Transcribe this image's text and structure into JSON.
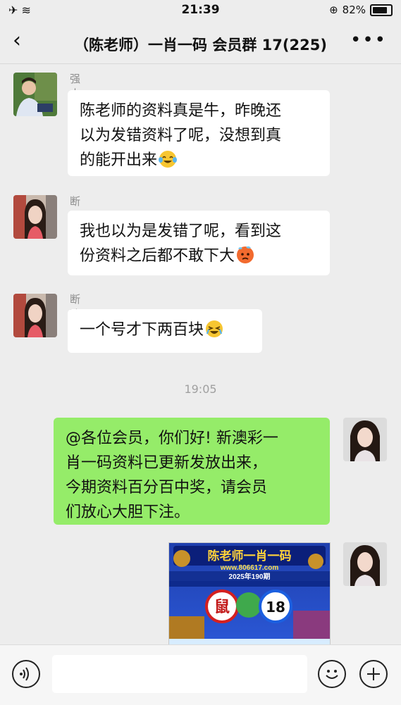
{
  "status_bar": {
    "time": "21:39",
    "battery": "82%",
    "battery_level": 0.82,
    "left_icons": "✈ ≋",
    "location_icon": "⊕"
  },
  "header": {
    "back_icon": "‹",
    "title": "（陈老师）一肖一码 会员群 17(225)",
    "more_icon": "•••"
  },
  "messages": [
    {
      "sender": "强大自我",
      "text_lines": [
        "陈老师的资料真是牛，昨晚还",
        "以为发错资料了呢，没想到真",
        "的能开出来"
      ],
      "emoji": "laugh-cry"
    },
    {
      "sender": "断弦的梦",
      "text_lines": [
        "我也以为是发错了呢，看到这",
        "份资料之后都不敢下大"
      ],
      "emoji": "sweat"
    },
    {
      "sender": "断弦的梦",
      "text_lines": [
        "一个号才下两百块"
      ],
      "emoji": "cry-laugh"
    }
  ],
  "timestamp": "19:05",
  "my_message": {
    "text_lines": [
      "@各位会员，你们好! 新澳彩一",
      "肖一码资料已更新发放出来，",
      "今期资料百分百中奖，请会员",
      "们放心大胆下注。"
    ]
  },
  "poster": {
    "title": "陈老师一肖一码",
    "url": "www.806617.com",
    "issue": "2025年190期",
    "zodiac": "鼠",
    "number": "18"
  },
  "colors": {
    "bg": "#ededed",
    "bubble_me": "#95ec69",
    "bubble_other": "#ffffff"
  },
  "icons": {
    "voice": "voice-icon",
    "emoji": "emoji-icon",
    "plus": "plus-icon"
  }
}
